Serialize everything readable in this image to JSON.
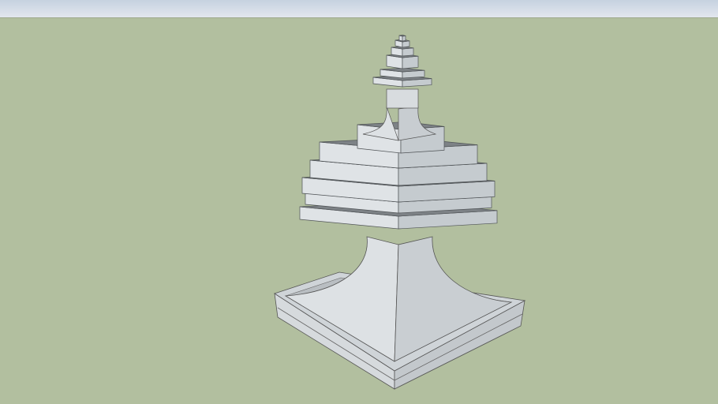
{
  "scene": {
    "sky_color": "#d2dbe7",
    "ground_color": "#b2bf9f",
    "model_light": "#dfe3e6",
    "model_mid": "#c5cbcf",
    "model_dark": "#7d8286"
  }
}
